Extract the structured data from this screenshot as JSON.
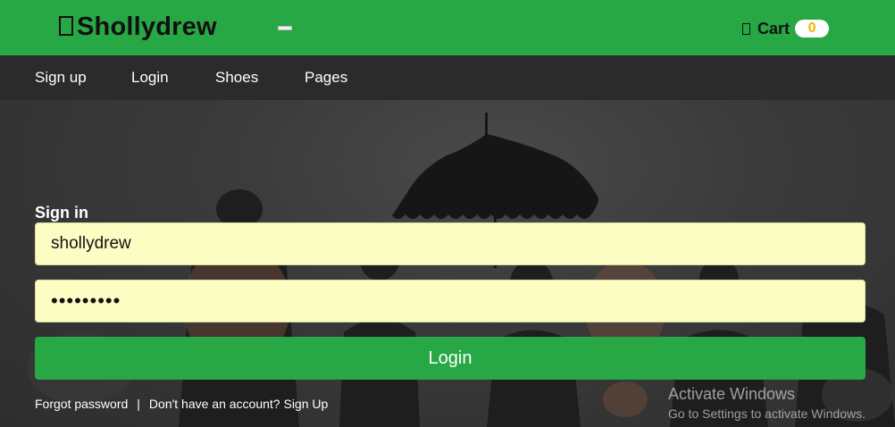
{
  "header": {
    "brand": "Shollydrew",
    "cart_label": "Cart",
    "cart_count": "0",
    "brand_color": "#28a745"
  },
  "nav": {
    "items": [
      {
        "label": "Sign up"
      },
      {
        "label": "Login"
      },
      {
        "label": "Shoes"
      },
      {
        "label": "Pages"
      }
    ]
  },
  "form": {
    "title": "Sign in",
    "username_value": "shollydrew",
    "password_value": "•••••••••",
    "submit_label": "Login",
    "forgot_label": "Forgot password",
    "separator": "|",
    "signup_prompt": "Don't have an account? Sign Up"
  },
  "watermark": {
    "title": "Activate Windows",
    "subtitle": "Go to Settings to activate Windows."
  }
}
